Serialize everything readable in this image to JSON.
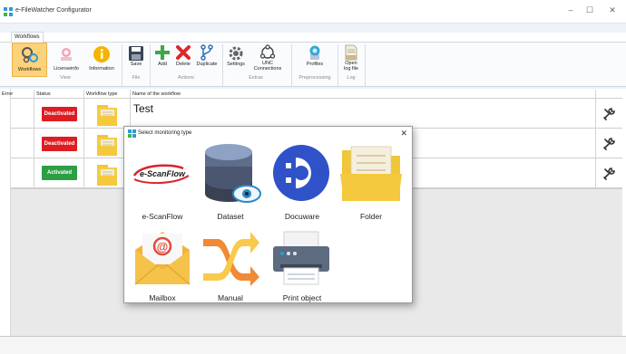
{
  "window": {
    "title": "e-FileWatcher Configurator",
    "controls": {
      "minimize": "–",
      "maximize": "☐",
      "close": "✕"
    }
  },
  "ribbon": {
    "tab": "Workflows",
    "buttons": {
      "workflows": "Workflows",
      "licenseinfo": "Licenseinfo",
      "information": "Information",
      "save": "Save",
      "add": "Add",
      "delete": "Delete",
      "duplicate": "Duplicate",
      "settings": "Settings",
      "unc_1": "UNC",
      "unc_2": "Connections",
      "profiles": "Profiles",
      "openlog_1": "Open",
      "openlog_2": "log file"
    },
    "groups": {
      "view": "View",
      "file": "File",
      "actions": "Actions",
      "extras": "Extras",
      "preprocessing": "Preprocessing",
      "log": "Log"
    }
  },
  "grid": {
    "columns": {
      "error": "Error",
      "status": "Status",
      "workflow_type": "Workflow type",
      "name": "Name of the workflow"
    },
    "rows": [
      {
        "status": "Deactivated",
        "name": "Test"
      },
      {
        "status": "Deactivated",
        "name": ""
      },
      {
        "status": "Activated",
        "name": ""
      }
    ]
  },
  "dialog": {
    "title": "Select monitoring type",
    "close": "✕",
    "tiles": {
      "escanflow": "e-ScanFlow",
      "dataset": "Dataset",
      "docuware": "Docuware",
      "folder": "Folder",
      "mailbox": "Mailbox",
      "manual": "Manual",
      "print": "Print object"
    },
    "logo_text": "e-ScanFlow"
  },
  "colors": {
    "deactivated": "#dd1d22",
    "activated": "#2c9f45",
    "selected_ribbon": "#fcd27a",
    "docuware": "#2f52c9"
  }
}
